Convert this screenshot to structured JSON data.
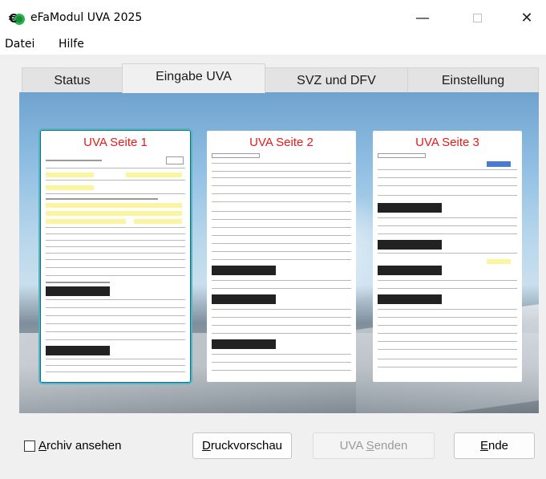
{
  "window": {
    "title": "eFaModul UVA 2025",
    "minimize": "—",
    "close": "✕"
  },
  "menu": {
    "items": [
      "Datei",
      "Hilfe"
    ]
  },
  "tabs": [
    {
      "label": "Status",
      "active": false
    },
    {
      "label": "Eingabe UVA",
      "active": true
    },
    {
      "label": "SVZ und DFV",
      "active": false
    },
    {
      "label": "Einstellung",
      "active": false
    }
  ],
  "pages": [
    {
      "title": "UVA Seite 1",
      "selected": true
    },
    {
      "title": "UVA Seite 2",
      "selected": false
    },
    {
      "title": "UVA Seite 3",
      "selected": false
    }
  ],
  "footer": {
    "archive_checkbox": {
      "first": "A",
      "rest": "rchiv ansehen",
      "checked": false
    },
    "preview_button": {
      "first": "D",
      "rest": "ruckvorschau"
    },
    "send_button": {
      "pre": "UVA ",
      "first": "S",
      "rest": "enden",
      "enabled": false
    },
    "end_button": {
      "first": "E",
      "rest": "nde"
    }
  },
  "colors": {
    "page_title": "#e51b1b",
    "selected_outline": "#4fb6c8"
  }
}
